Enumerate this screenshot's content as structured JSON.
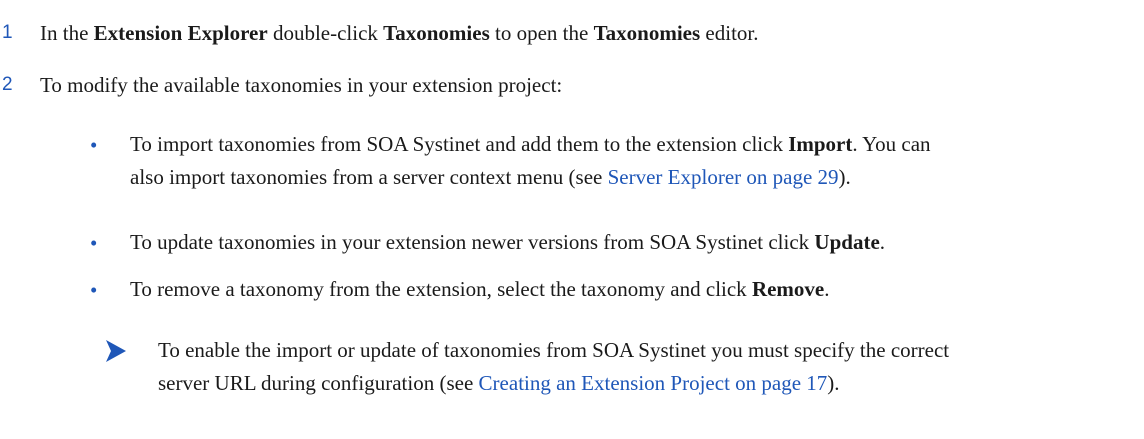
{
  "steps": [
    {
      "number": "1",
      "parts": {
        "t1": "In the ",
        "b1": "Extension Explorer",
        "t2": " double-click ",
        "b2": "Taxonomies",
        "t3": " to open the ",
        "b3": "Taxonomies",
        "t4": " editor."
      }
    },
    {
      "number": "2",
      "text": "To modify the available taxonomies in your extension project:"
    }
  ],
  "bullets": [
    {
      "glyph": "•",
      "line1": "To import taxonomies from SOA Systinet and add them to the extension click ",
      "bold": "Import",
      "after_bold": ". You can",
      "line2_pre": "also import taxonomies from a server context menu (see ",
      "link": "Server Explorer on page 29",
      "line2_post": ")."
    },
    {
      "glyph": "•",
      "text": "To update taxonomies in your extension newer versions from SOA Systinet click ",
      "bold": "Update",
      "after_bold": "."
    },
    {
      "glyph": "•",
      "text": "To remove a taxonomy from the extension, select the taxonomy and click ",
      "bold": "Remove",
      "after_bold": "."
    }
  ],
  "note": {
    "icon": "note-arrow-icon",
    "line1": "To enable the import or update of taxonomies from SOA Systinet you must specify the correct",
    "line2_pre": "server URL during configuration (see ",
    "link": "Creating an Extension Project on page 17",
    "line2_post": ")."
  },
  "colors": {
    "accent": "#1f57b8",
    "text": "#1a1a1a"
  }
}
